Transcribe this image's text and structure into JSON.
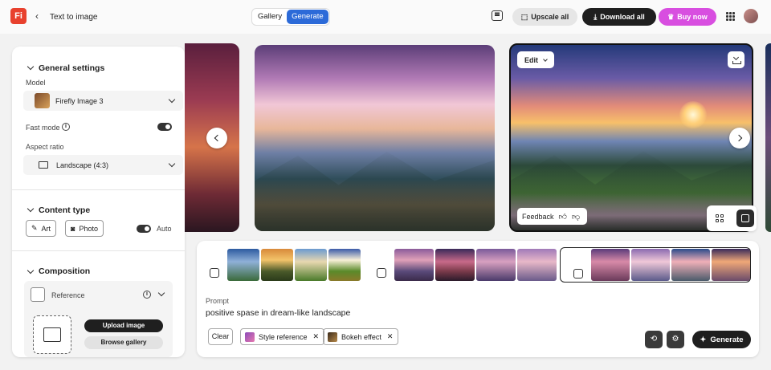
{
  "app": {
    "logo": "Fi",
    "title": "Text to image"
  },
  "view_tabs": [
    {
      "label": "Gallery",
      "active": false
    },
    {
      "label": "Generate",
      "active": true
    }
  ],
  "header": {
    "upscale_label": "Upscale all",
    "download_label": "Download all",
    "buy_label": "Buy now"
  },
  "sidebar": {
    "general": {
      "title": "General settings",
      "model_label": "Model",
      "model_value": "Firefly Image 3",
      "fast_mode_label": "Fast mode",
      "fast_mode_on": true,
      "aspect_label": "Aspect ratio",
      "aspect_value": "Landscape (4:3)"
    },
    "content_type": {
      "title": "Content type",
      "art_label": "Art",
      "photo_label": "Photo",
      "auto_label": "Auto",
      "auto_on": true
    },
    "composition": {
      "title": "Composition",
      "reference_label": "Reference",
      "upload_label": "Upload image",
      "browse_label": "Browse gallery"
    }
  },
  "viewer": {
    "edit_label": "Edit",
    "feedback_label": "Feedback"
  },
  "prompt": {
    "label": "Prompt",
    "text": "positive spase in dream-like landscape",
    "clear_label": "Clear",
    "chips": [
      {
        "label": "Style reference"
      },
      {
        "label": "Bokeh effect"
      }
    ],
    "generate_label": "Generate"
  },
  "colors": {
    "accent_blue": "#2c6ad8",
    "logo_red": "#e8412e",
    "buy_magenta": "#d84ee0",
    "dark_button": "#1f1f1f"
  }
}
